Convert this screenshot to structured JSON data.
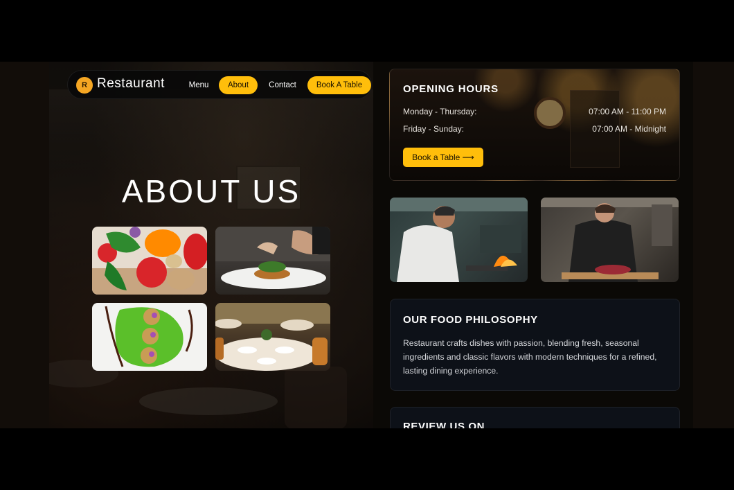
{
  "nav": {
    "logo_letter": "R",
    "brand": "Restaurant",
    "items": [
      {
        "label": "Menu",
        "active": false
      },
      {
        "label": "About",
        "active": true
      },
      {
        "label": "Contact",
        "active": false
      }
    ],
    "cta": "Book A Table"
  },
  "hero": {
    "title": "ABOUT US"
  },
  "gallery": [
    {
      "name": "vegetables"
    },
    {
      "name": "plated-dish"
    },
    {
      "name": "green-puree-dish"
    },
    {
      "name": "dining-room"
    }
  ],
  "hours": {
    "title": "OPENING HOURS",
    "rows": [
      {
        "days": "Monday - Thursday:",
        "time": "07:00 AM - 11:00 PM"
      },
      {
        "days": "Friday - Sunday:",
        "time": "07:00 AM - Midnight"
      }
    ],
    "button": "Book a Table ⟶"
  },
  "philosophy": {
    "title": "OUR FOOD PHILOSOPHY",
    "text": "Restaurant crafts dishes with passion, blending fresh, seasonal ingredients and classic flavors with modern techniques for a refined, lasting dining experience."
  },
  "review": {
    "title": "REVIEW US ON"
  },
  "colors": {
    "accent": "#ffbe0b",
    "card_bg": "#0d1118",
    "page_bg": "#000000"
  }
}
